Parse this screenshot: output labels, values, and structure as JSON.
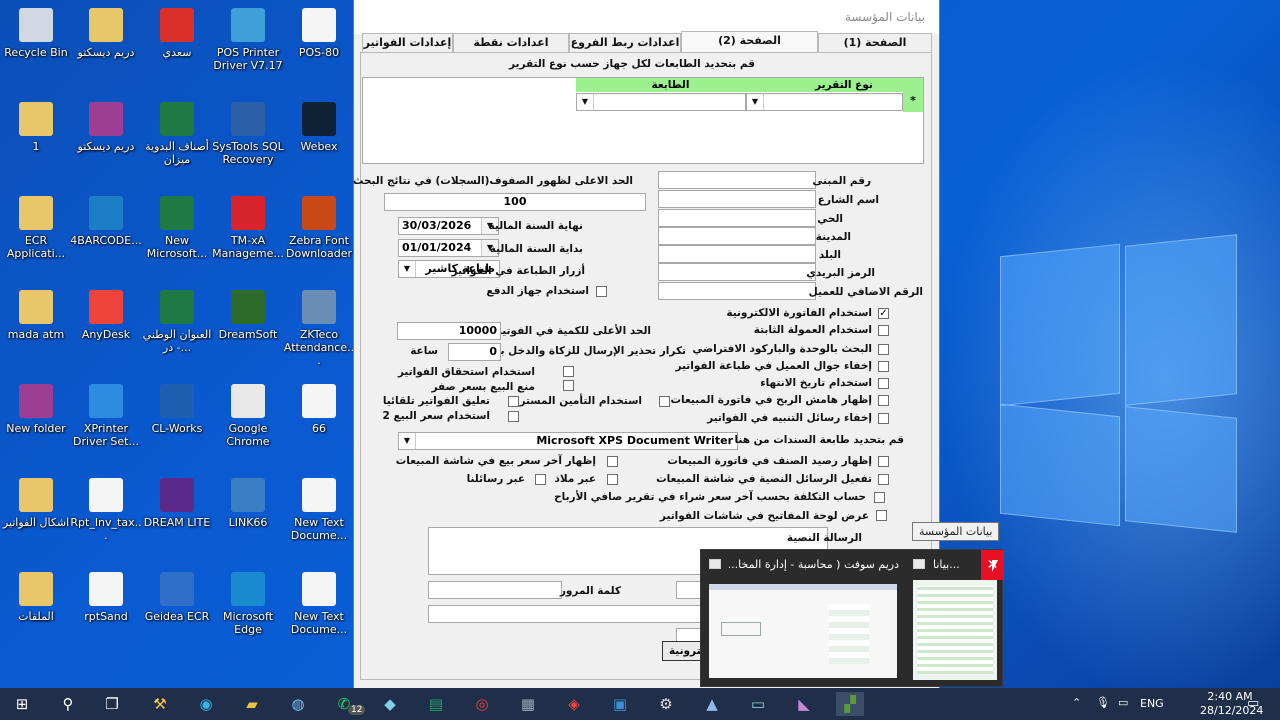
{
  "desktop": {
    "icons": [
      {
        "id": "recycle",
        "label": "Recycle Bin",
        "icon": "recycle-bin-icon",
        "color": "#cfd8e3"
      },
      {
        "id": "d1",
        "label": "دريم ديسكتو",
        "icon": "folder-zip-icon",
        "color": "#e8c66a"
      },
      {
        "id": "pdf",
        "label": "سعدي",
        "icon": "pdf-icon",
        "color": "#d9302a"
      },
      {
        "id": "pos",
        "label": "POS Printer Driver V7.17",
        "icon": "printer-icon",
        "color": "#3f9fd9"
      },
      {
        "id": "pos80",
        "label": "POS-80",
        "icon": "document-icon",
        "color": "#f5f5f5"
      },
      {
        "id": "one",
        "label": "1",
        "icon": "folder-zip-icon",
        "color": "#e8c66a"
      },
      {
        "id": "d2",
        "label": "دريم ديسكتو",
        "icon": "winrar-icon",
        "color": "#9c3f94"
      },
      {
        "id": "xl1",
        "label": "أصناف البدوية ميزان",
        "icon": "excel-icon",
        "color": "#1e7a45"
      },
      {
        "id": "sys",
        "label": "SysTools SQL Recovery",
        "icon": "systools-icon",
        "color": "#2b5fa8"
      },
      {
        "id": "webex",
        "label": "Webex",
        "icon": "webex-icon",
        "color": "#0f2237"
      },
      {
        "id": "ecr",
        "label": "ECR Applicati...",
        "icon": "folder-icon",
        "color": "#e8c66a"
      },
      {
        "id": "barcode",
        "label": "4BARCODE...",
        "icon": "barcode-app-icon",
        "color": "#1c7ec4"
      },
      {
        "id": "xl2",
        "label": "New Microsoft...",
        "icon": "excel-icon",
        "color": "#1e7a45"
      },
      {
        "id": "tm",
        "label": "TM-xA Manageme...",
        "icon": "epson-icon",
        "color": "#d6242a"
      },
      {
        "id": "zebra",
        "label": "Zebra Font Downloader",
        "icon": "font-icon",
        "color": "#c94a18"
      },
      {
        "id": "atm",
        "label": "mada atm",
        "icon": "folder-icon",
        "color": "#e8c66a"
      },
      {
        "id": "anydesk",
        "label": "AnyDesk",
        "icon": "anydesk-icon",
        "color": "#ef443b"
      },
      {
        "id": "xl3",
        "label": "العنوان الوطني - در...",
        "icon": "excel-icon",
        "color": "#1e7a45"
      },
      {
        "id": "dream",
        "label": "DreamSoft",
        "icon": "dreamsoft-icon",
        "color": "#2d6b2a"
      },
      {
        "id": "zk",
        "label": "ZKTeco Attendance...",
        "icon": "clock-icon",
        "color": "#6b8cb5"
      },
      {
        "id": "newf",
        "label": "New folder",
        "icon": "winrar-icon",
        "color": "#9c3f94"
      },
      {
        "id": "xp",
        "label": "XPrinter Driver Set...",
        "icon": "xprinter-icon",
        "color": "#2e8ce0"
      },
      {
        "id": "cl",
        "label": "CL-Works",
        "icon": "cl-works-icon",
        "color": "#1e5fb0"
      },
      {
        "id": "chrome",
        "label": "Google Chrome",
        "icon": "chrome-icon",
        "color": "#e8e8e8"
      },
      {
        "id": "n66",
        "label": "66",
        "icon": "document-icon",
        "color": "#f5f5f5"
      },
      {
        "id": "ashkal",
        "label": "اشكال الفواتير",
        "icon": "folder-icon",
        "color": "#e8c66a"
      },
      {
        "id": "rpt",
        "label": "Rpt_Inv_tax...",
        "icon": "report-icon",
        "color": "#f5f5f5"
      },
      {
        "id": "dlite",
        "label": "DREAM LITE",
        "icon": "dream-lite-icon",
        "color": "#5a2a8a"
      },
      {
        "id": "link",
        "label": "LINK66",
        "icon": "globe-icon",
        "color": "#3a7fc4"
      },
      {
        "id": "txt1",
        "label": "New Text Docume...",
        "icon": "document-icon",
        "color": "#f5f5f5"
      },
      {
        "id": "files",
        "label": "الملفات",
        "icon": "folder-icon",
        "color": "#e8c66a"
      },
      {
        "id": "rptsand",
        "label": "rptSand",
        "icon": "report-icon",
        "color": "#f5f5f5"
      },
      {
        "id": "geidea",
        "label": "Geidea ECR",
        "icon": "window-app-icon",
        "color": "#2f6fc9"
      },
      {
        "id": "edge",
        "label": "Microsoft Edge",
        "icon": "edge-icon",
        "color": "#1a8bd1"
      },
      {
        "id": "txt2",
        "label": "New Text Docume...",
        "icon": "document-icon",
        "color": "#f5f5f5"
      }
    ]
  },
  "window": {
    "title": "بيانات المؤسسة",
    "tabs": [
      {
        "label": "الصفحة (1)"
      },
      {
        "label": "الصفحة (2)"
      },
      {
        "label": "اعدادات ربط الفروع"
      },
      {
        "label": "اعدادات نقطة المبيعات"
      },
      {
        "label": "إعدادات الفواتير"
      }
    ],
    "printer_title": "قم بتحديد الطابعات لكل جهاز حسب نوع التقرير",
    "grid": {
      "col_report": "نوع التقرير",
      "col_printer": "الطابعة",
      "row_marker": "*"
    },
    "right_fields": {
      "building_no": "رقم المبنى",
      "street": "اسم الشارع",
      "district": "الحي",
      "city": "المدينة",
      "country": "البلد",
      "postal": "الرمز البريدي",
      "extra_no": "الرقم الاضافي للعميل"
    },
    "max_rows_label": "الحد الاعلى لظهور الصفوف(السجلات) في نتائج البحث",
    "max_rows_value": "100",
    "fy_end_label": "نهاية السنة المالية",
    "fy_end_value": "30/03/2026",
    "fy_start_label": "بداية السنة المالية",
    "fy_start_value": "01/01/2024",
    "print_buttons_label": "أزرار الطباعة في الفواتير",
    "print_buttons_value": "طباعة كاشير",
    "payment_device_label": "استخدام جهاز الدفع",
    "right_checks": [
      {
        "label": "استخدام الفاتورة الالكترونية",
        "checked": true
      },
      {
        "label": "استخدام العمولة الثابتة",
        "checked": false
      },
      {
        "label": "البحث بالوحدة والباركود الافتراضي",
        "checked": false
      },
      {
        "label": "إخفاء جوال العميل في طباعة الفواتير",
        "checked": false
      },
      {
        "label": "استخدام تاريخ الانتهاء",
        "checked": false
      },
      {
        "label": "إظهار هامش الربح في فاتورة المبيعات",
        "checked": false
      },
      {
        "label": "إخفاء رسائل التنبيه في الفواتير",
        "checked": false
      }
    ],
    "max_qty_label": "الحد الأعلى للكمية في الفوتير",
    "max_qty_value": "10000",
    "repeat_warn_label": "تكرار تحذير الإرسال للزكاة والدخل بعد",
    "repeat_warn_value": "0",
    "hour_label": "ساعة",
    "mid_checks": [
      {
        "label": "استخدام استحقاق الفواتير"
      },
      {
        "label": "منع البيع بسعر صفر"
      },
      {
        "label": "استخدام التأمين المسترد"
      },
      {
        "label": "تعليق الفواتير تلقائيا"
      },
      {
        "label": "استخدام سعر البيع 2"
      }
    ],
    "doc_printer_label": "قم بتحديد طابعة السندات من هنا",
    "doc_printer_value": "Microsoft XPS Document Writer",
    "lower_checks": [
      {
        "label": "إظهار رصيد الصنف في فاتورة المبيعات"
      },
      {
        "label": "إظهار آخر سعر بيع في شاشة المبيعات"
      },
      {
        "label": "تفعيل الرسائل النصية في شاشة المبيعات"
      },
      {
        "label": "عبر ملاذ"
      },
      {
        "label": "عبر رسائلنا"
      },
      {
        "label": "حساب التكلفة بحسب آخر سعر شراء في تقرير صافي الأرباح"
      },
      {
        "label": "عرض لوحة المفاتيح في شاشات الفواتير"
      }
    ],
    "sms_label": "الرسالة النصية",
    "password_label": "كلمة المرور",
    "bottom_button": "كترونية"
  },
  "thumbs": {
    "tooltip": "بيانات المؤسسة",
    "t1": "دريم سوفت ( محاسبة - إدارة المخا...",
    "t2": "بيانا..."
  },
  "taskbar": {
    "time": "2:40 AM",
    "date": "28/12/2024",
    "lang": "ENG",
    "whatsapp_badge": "12"
  }
}
